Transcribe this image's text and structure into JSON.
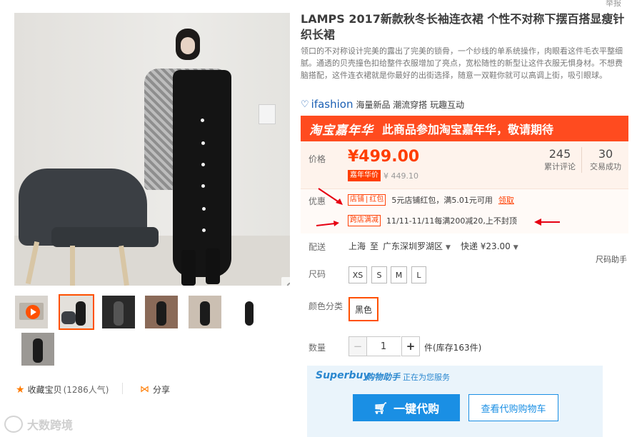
{
  "top_right_fragment": "举报",
  "product": {
    "title": "LAMPS 2017新款秋冬长袖连衣裙 个性不对称下摆百搭显瘦针织长裙",
    "description": "领口的不对称设计完美的露出了完美的锁骨，一个纱线的单系统操作，肉眼看这件毛衣平整细腻。通透的贝壳撞色扣给整件衣服增加了亮点，宽松随性的新型让这件衣服无惧身材。不想费脑搭配，这件连衣裙就是你最好的出街选择，随意一双鞋你就可以高调上街，吸引眼球。"
  },
  "ifashion": {
    "logo": "ifashion",
    "tagline": "海量新品 潮流穿搭 玩趣互动"
  },
  "banner": {
    "logo_text": "淘宝嘉年华",
    "message": "此商品参加淘宝嘉年华，敬请期待",
    "color": "#ff4b1f"
  },
  "price": {
    "label": "价格",
    "value": "¥499.00",
    "promo_tag": "嘉年华价",
    "promo_value": "¥ 449.10",
    "color": "#ff3e00"
  },
  "stats": {
    "reviews_count": "245",
    "reviews_label": "累计评论",
    "sales_count": "30",
    "sales_label": "交易成功"
  },
  "promotions": {
    "label": "优惠",
    "coupon_tag": "店铺",
    "coupon_tag2": "红包",
    "coupon_text": "5元店铺红包，满5.01元可用",
    "coupon_link": "领取",
    "cross_tag": "跨店满减",
    "cross_text": "11/11-11/11每满200减20,上不封顶"
  },
  "shipping": {
    "label": "配送",
    "from": "上海",
    "to_word": "至",
    "destination": "广东深圳罗湖区",
    "method": "快递 ¥23.00",
    "size_helper": "尺码助手"
  },
  "size": {
    "label": "尺码",
    "options": [
      "XS",
      "S",
      "M",
      "L"
    ]
  },
  "color": {
    "label": "颜色分类",
    "selected": "黑色"
  },
  "quantity": {
    "label": "数量",
    "minus": "−",
    "value": "1",
    "plus": "+",
    "stock": "件(库存163件)"
  },
  "superbuy": {
    "logo": "Superbuy",
    "sub": "购物助手",
    "serving": "正在为您服务",
    "buy_label": "一键代购",
    "cart_label": "查看代购购物车",
    "accent": "#1a8fe4"
  },
  "footer": {
    "favorite_label": "收藏宝贝",
    "favorite_count": "(1286人气)",
    "share_label": "分享"
  },
  "watermark": "大数跨境"
}
